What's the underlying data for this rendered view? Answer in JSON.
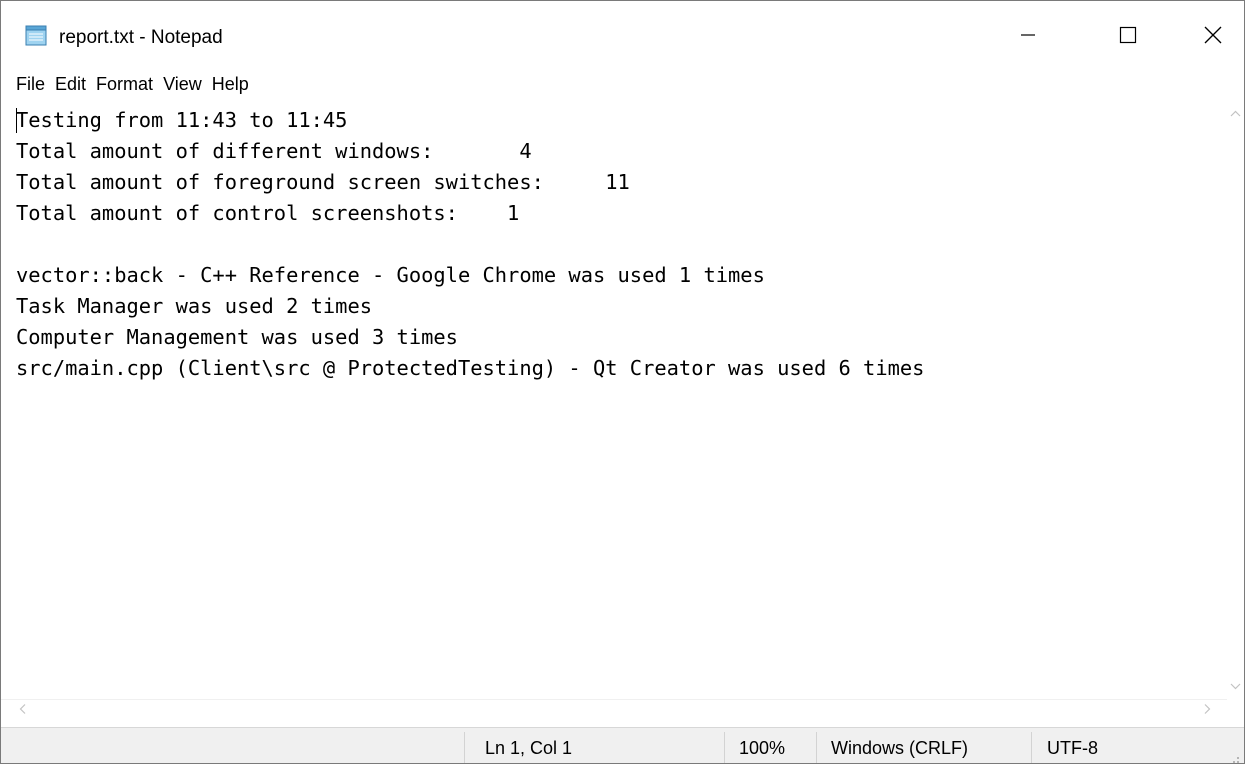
{
  "window": {
    "title": "report.txt - Notepad"
  },
  "icons": {
    "app": "notepad-icon",
    "minimize": "minimize-icon",
    "maximize": "maximize-icon",
    "close": "close-icon"
  },
  "menu": {
    "items": [
      "File",
      "Edit",
      "Format",
      "View",
      "Help"
    ]
  },
  "editor": {
    "lines": [
      "Testing from 11:43 to 11:45",
      "Total amount of different windows:       4",
      "Total amount of foreground screen switches:     11",
      "Total amount of control screenshots:    1",
      "",
      "vector::back - C++ Reference - Google Chrome was used 1 times",
      "Task Manager was used 2 times",
      "Computer Management was used 3 times",
      "src/main.cpp (Client\\src @ ProtectedTesting) - Qt Creator was used 6 times"
    ]
  },
  "statusbar": {
    "position": "Ln 1, Col 1",
    "zoom": "100%",
    "line_ending": "Windows (CRLF)",
    "encoding": "UTF-8"
  }
}
